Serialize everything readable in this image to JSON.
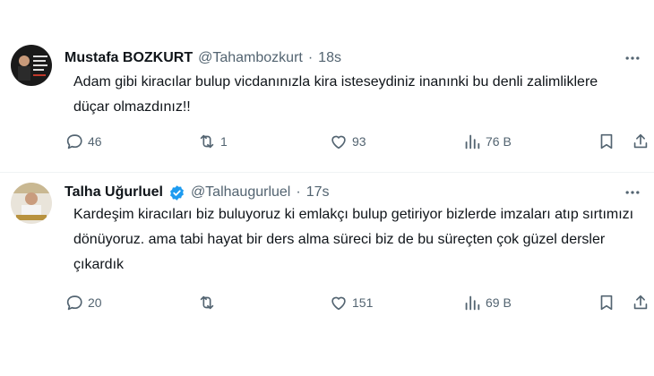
{
  "tweets": [
    {
      "name": "Mustafa BOZKURT",
      "handle": "@Tahambozkurt",
      "dot": "·",
      "time": "18s",
      "verified": false,
      "text": "Adam gibi kiracılar bulup vicdanınızla kira isteseydiniz inanınki bu denli zalimliklere düçar olmazdınız!!",
      "replies": "46",
      "retweets": "1",
      "likes": "93",
      "views": "76 B"
    },
    {
      "name": "Talha Uğurluel",
      "handle": "@Talhaugurluel",
      "dot": "·",
      "time": "17s",
      "verified": true,
      "text": "Kardeşim kiracıları biz buluyoruz ki emlakçı bulup getiriyor bizlerde imzaları atıp sırtımızı dönüyoruz. ama tabi hayat bir ders alma süreci biz de bu süreçten çok güzel dersler çıkardık",
      "replies": "20",
      "retweets": "",
      "likes": "151",
      "views": "69 B"
    }
  ],
  "colors": {
    "text": "#0f1419",
    "secondary": "#536471",
    "verified": "#1d9bf0",
    "divider": "#eff3f4"
  },
  "icons": [
    "reply-icon",
    "retweet-icon",
    "like-icon",
    "views-icon",
    "bookmark-icon",
    "share-icon",
    "more-icon",
    "verified-badge-icon"
  ]
}
